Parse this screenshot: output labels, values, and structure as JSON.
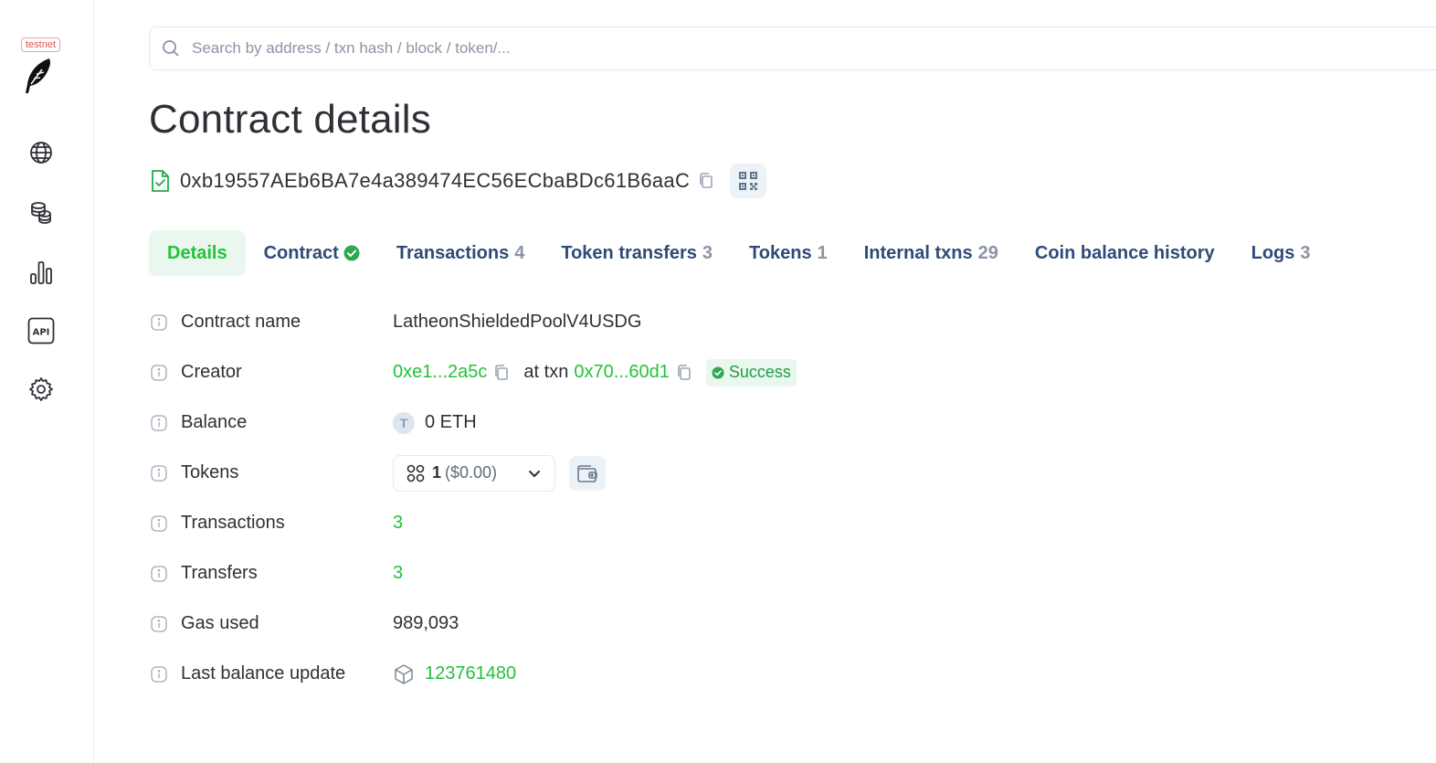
{
  "sidebar": {
    "network_badge": "testnet",
    "items": [
      {
        "icon": "globe-icon"
      },
      {
        "icon": "coins-icon"
      },
      {
        "icon": "bar-chart-icon"
      },
      {
        "icon": "api-icon",
        "label": "API"
      },
      {
        "icon": "gear-icon"
      }
    ]
  },
  "search": {
    "placeholder": "Search by address / txn hash / block / token/..."
  },
  "page": {
    "title": "Contract details",
    "address": "0xb19557AEb6BA7e4a389474EC56ECbaBDc61B6aaC"
  },
  "tabs": [
    {
      "label": "Details",
      "count": "",
      "active": true
    },
    {
      "label": "Contract",
      "count": "",
      "verified": true
    },
    {
      "label": "Transactions",
      "count": "4"
    },
    {
      "label": "Token transfers",
      "count": "3"
    },
    {
      "label": "Tokens",
      "count": "1"
    },
    {
      "label": "Internal txns",
      "count": "29"
    },
    {
      "label": "Coin balance history",
      "count": ""
    },
    {
      "label": "Logs",
      "count": "3"
    }
  ],
  "details": {
    "contract_name": {
      "label": "Contract name",
      "value": "LatheonShieldedPoolV4USDG"
    },
    "creator": {
      "label": "Creator",
      "address": "0xe1...2a5c",
      "at_txn": "at txn",
      "txn": "0x70...60d1",
      "status": "Success"
    },
    "balance": {
      "label": "Balance",
      "token_letter": "T",
      "value": "0 ETH"
    },
    "tokens": {
      "label": "Tokens",
      "count": "1",
      "usd": "($0.00)"
    },
    "transactions": {
      "label": "Transactions",
      "value": "3"
    },
    "transfers": {
      "label": "Transfers",
      "value": "3"
    },
    "gas_used": {
      "label": "Gas used",
      "value": "989,093"
    },
    "last_balance_update": {
      "label": "Last balance update",
      "value": "123761480"
    }
  },
  "colors": {
    "accent_green": "#22c33a",
    "tab_blue": "#2f4a78",
    "muted_gray": "#8a94a6"
  }
}
